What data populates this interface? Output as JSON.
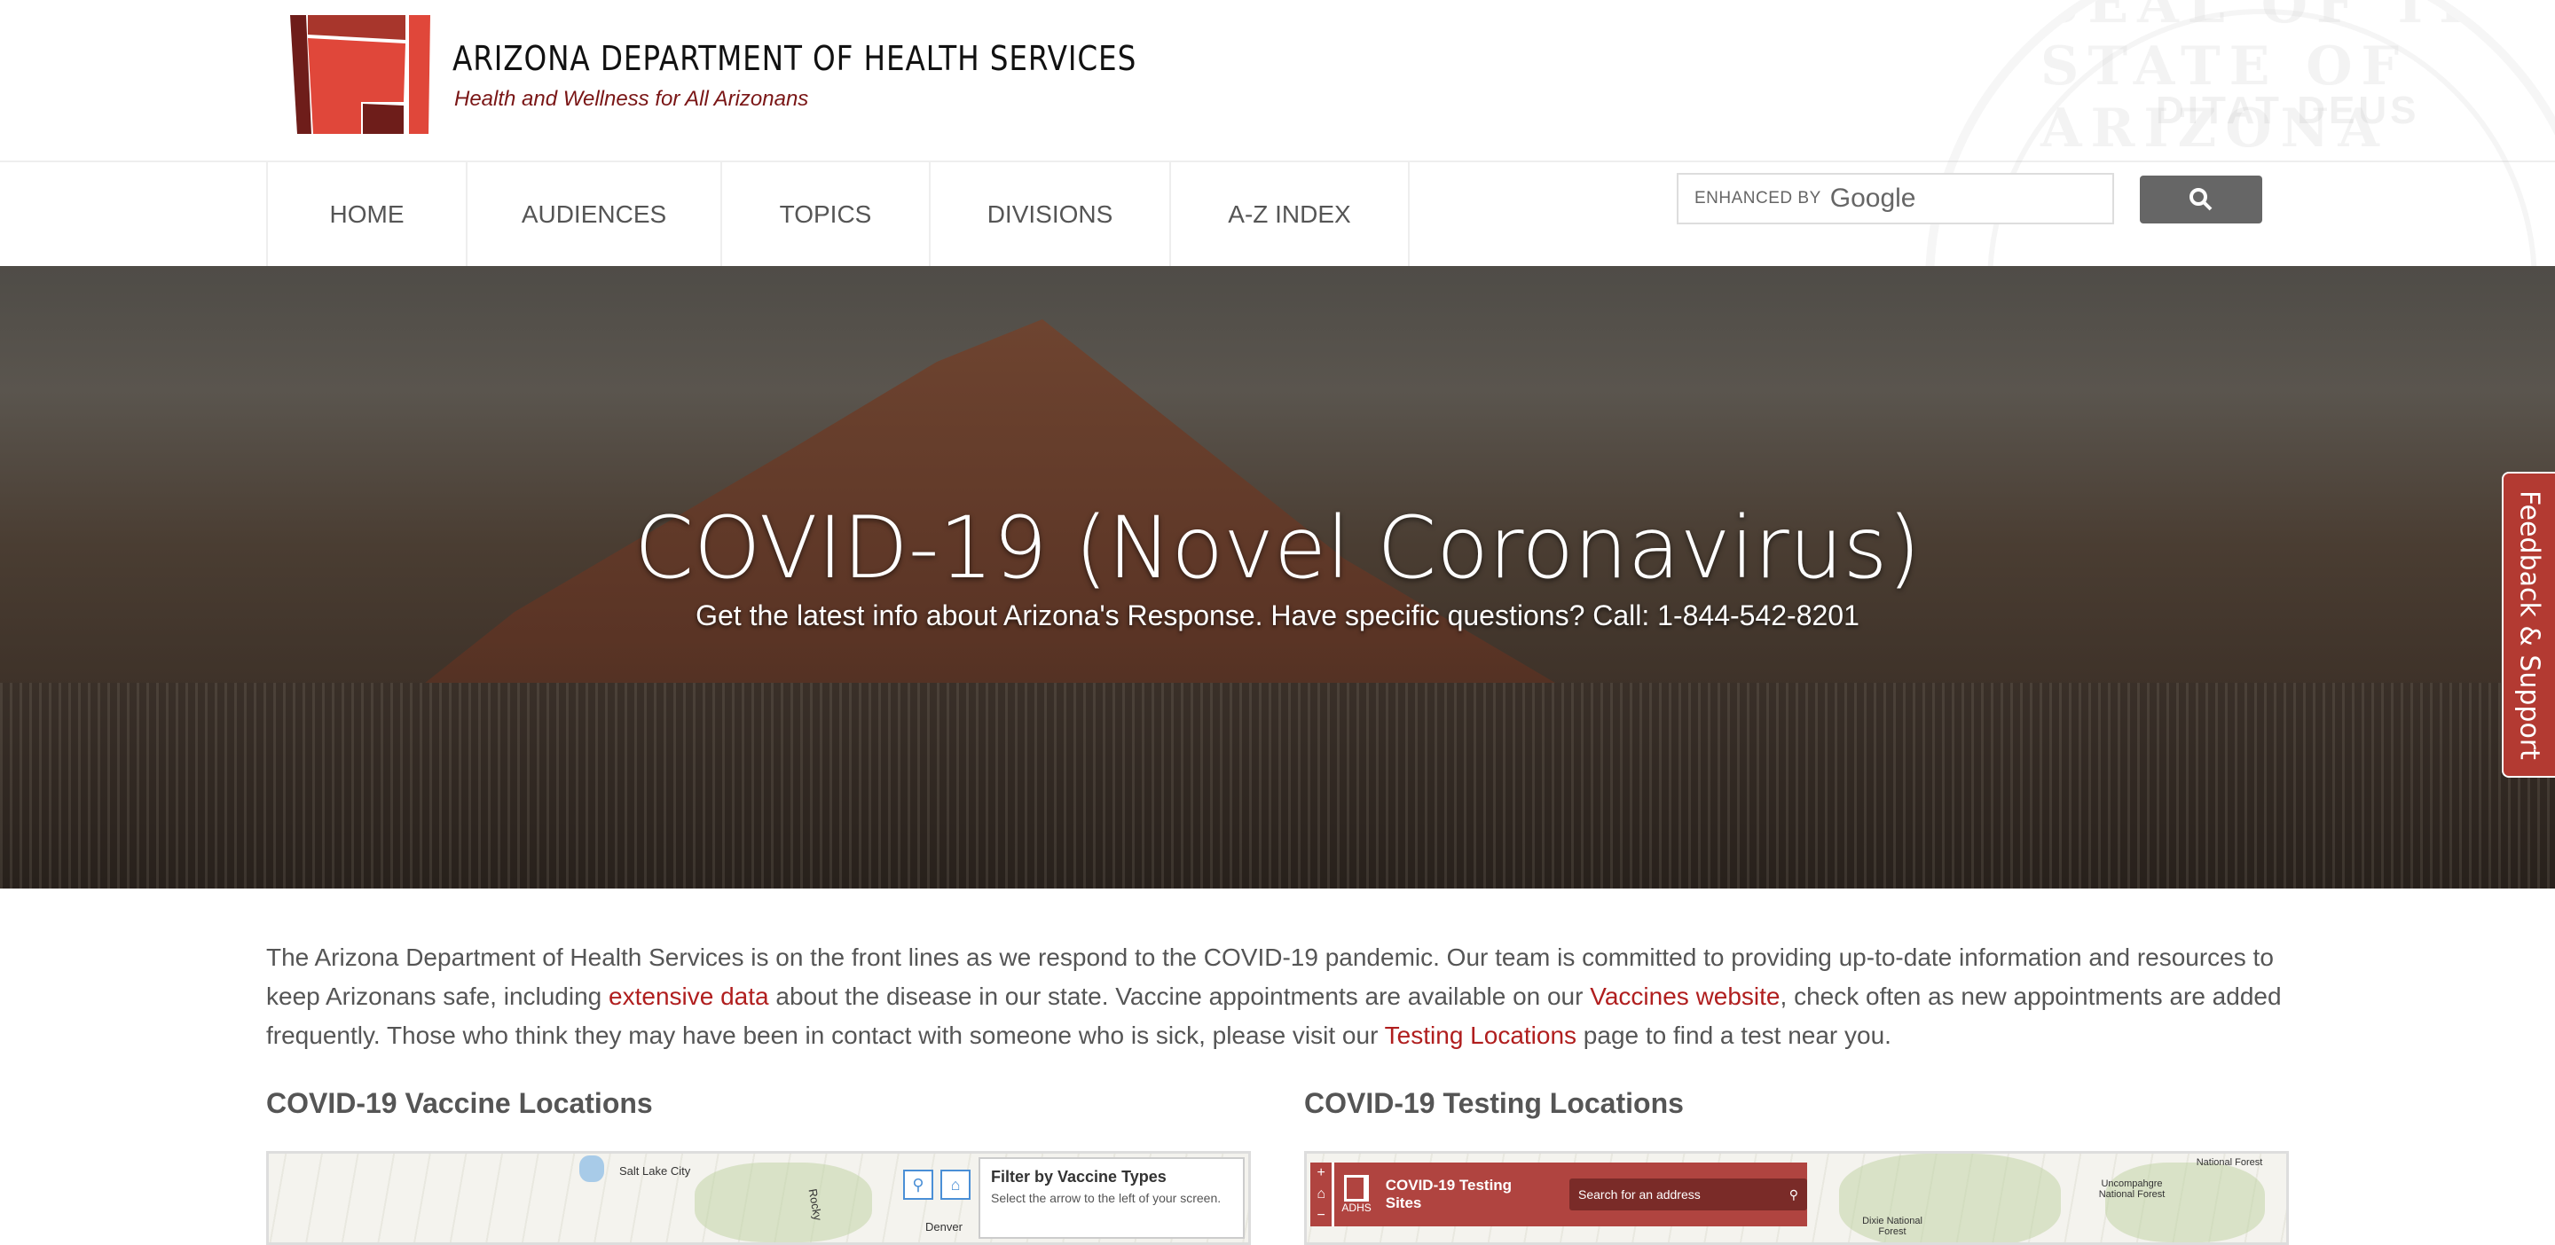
{
  "header": {
    "title": "ARIZONA DEPARTMENT OF HEALTH SERVICES",
    "tagline": "Health and Wellness for All Arizonans",
    "seal_text": "SEAL OF THE STATE OF ARIZONA",
    "seal_motto": "DITAT DEUS"
  },
  "nav": {
    "items": [
      {
        "label": "HOME"
      },
      {
        "label": "AUDIENCES"
      },
      {
        "label": "TOPICS"
      },
      {
        "label": "DIVISIONS"
      },
      {
        "label": "A-Z INDEX"
      }
    ]
  },
  "search": {
    "enhanced_by": "ENHANCED BY",
    "brand": "Google",
    "button_icon": "search-icon"
  },
  "hero": {
    "title": "COVID-19 (Novel Coronavirus)",
    "subtitle": "Get the latest info about Arizona's Response. Have specific questions? Call: 1-844-542-8201"
  },
  "feedback": {
    "label": "Feedback & Support"
  },
  "intro": {
    "t1": "The Arizona Department of Health Services is on the front lines as we respond to the COVID-19 pandemic. Our team is committed to providing up-to-date information and resources to keep Arizonans safe, including ",
    "link1": "extensive data",
    "t2": " about the disease in our state. Vaccine appointments are available on our ",
    "link2": "Vaccines website",
    "t3": ", check often as new appointments are added frequently. Those who think they may have been in contact with someone who is sick, please visit our ",
    "link3": "Testing Locations",
    "t4": " page to find a test near you."
  },
  "vaccine": {
    "heading": "COVID-19 Vaccine Locations",
    "map_labels": [
      "Salt Lake City",
      "Rocky",
      "Denver"
    ],
    "filter_title": "Filter by Vaccine Types",
    "filter_desc": "Select the arrow to the left of your screen."
  },
  "testing": {
    "heading": "COVID-19 Testing Locations",
    "logo_text": "ADHS",
    "title": "COVID-19 Testing Sites",
    "search_placeholder": "Search for an address",
    "map_labels": [
      "National Forest",
      "Uncompahgre National Forest",
      "Dixie National Forest"
    ]
  },
  "colors": {
    "brand_red": "#b01e1e",
    "tagline": "#7a1616",
    "feedback": "#b33a32"
  }
}
